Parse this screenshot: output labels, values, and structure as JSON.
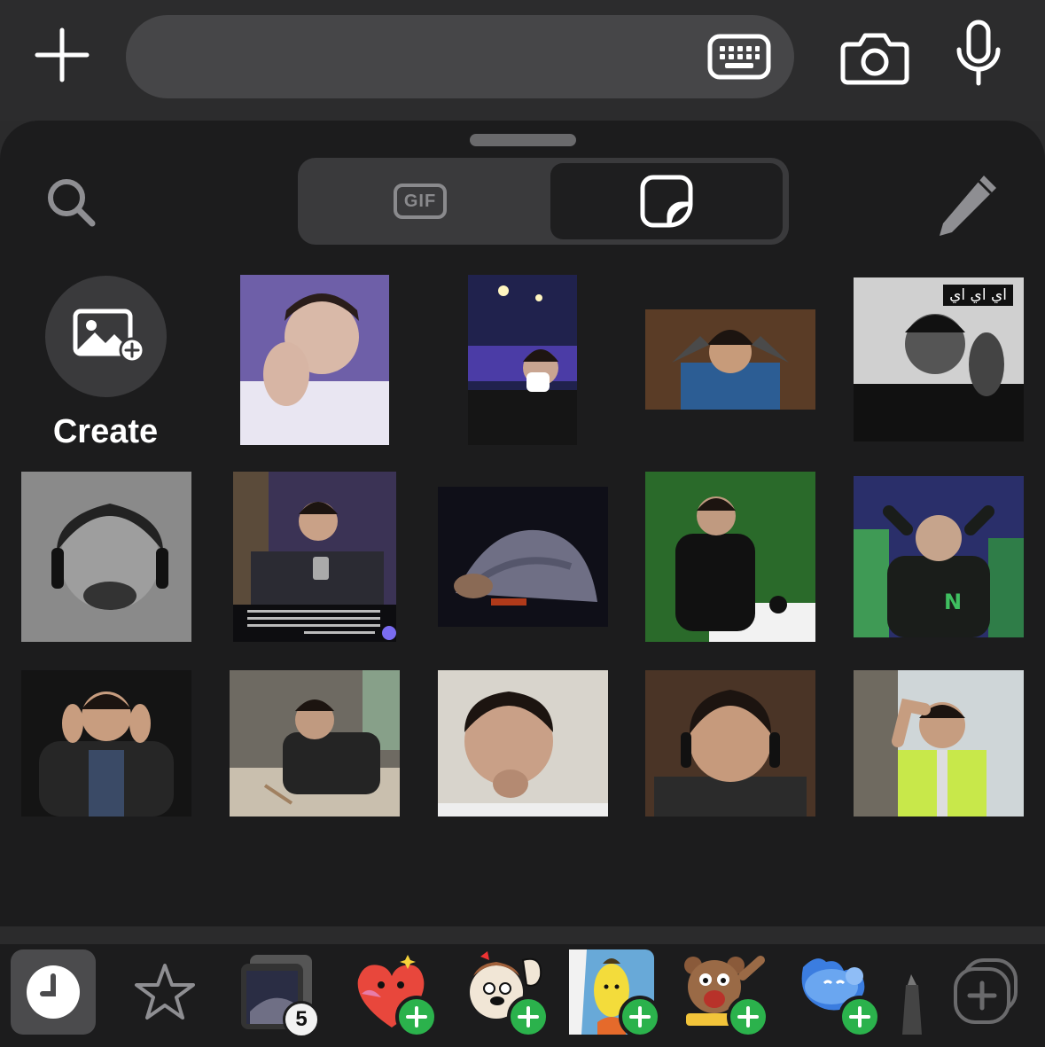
{
  "composer": {
    "message_value": "",
    "icons": {
      "add": "plus-icon",
      "keyboard": "keyboard-icon",
      "camera": "camera-icon",
      "mic": "microphone-icon"
    }
  },
  "panel": {
    "segments": [
      {
        "label": "GIF",
        "selected": false
      },
      {
        "label": "",
        "icon": "sticker-icon",
        "selected": true
      }
    ],
    "icons": {
      "search": "magnifier-icon",
      "edit": "pencil-icon"
    }
  },
  "create": {
    "label": "Create",
    "icon": "add-photo-icon"
  },
  "stickers": {
    "caption_ar": "اي اي اي",
    "items": [
      {
        "id": "s1"
      },
      {
        "id": "s2"
      },
      {
        "id": "s3"
      },
      {
        "id": "s4"
      },
      {
        "id": "s5"
      },
      {
        "id": "s6"
      },
      {
        "id": "s7"
      },
      {
        "id": "s8"
      },
      {
        "id": "s9"
      },
      {
        "id": "s10"
      },
      {
        "id": "s11"
      },
      {
        "id": "s12"
      },
      {
        "id": "s13"
      },
      {
        "id": "s14"
      }
    ]
  },
  "tray": {
    "items": [
      {
        "name": "recent",
        "icon": "clock-icon",
        "selected": true
      },
      {
        "name": "favorites",
        "icon": "star-icon"
      },
      {
        "name": "my-pack",
        "badge": "5"
      },
      {
        "name": "red-heart-pack",
        "add": true
      },
      {
        "name": "squirrel-pack",
        "add": true
      },
      {
        "name": "yellow-blob-pack",
        "add": true
      },
      {
        "name": "bear-pack",
        "add": true
      },
      {
        "name": "blue-cloud-pack",
        "add": true
      },
      {
        "name": "add-pack",
        "icon": "add-stack-icon"
      }
    ]
  }
}
